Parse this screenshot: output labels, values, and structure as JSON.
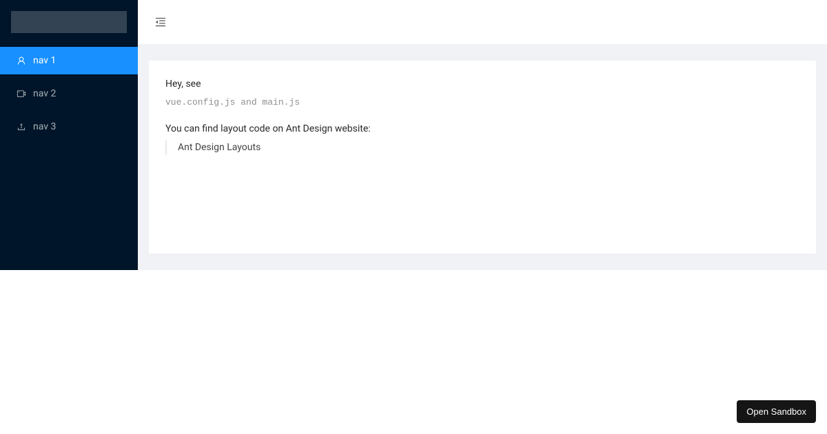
{
  "sidebar": {
    "items": [
      {
        "label": "nav 1",
        "icon": "user-icon",
        "selected": true
      },
      {
        "label": "nav 2",
        "icon": "video-camera-icon",
        "selected": false
      },
      {
        "label": "nav 3",
        "icon": "upload-icon",
        "selected": false
      }
    ]
  },
  "content": {
    "line1": "Hey, see",
    "code_line": "vue.config.js and main.js",
    "line2": "You can find layout code on Ant Design website:",
    "link_label": "Ant Design Layouts"
  },
  "sandbox_button": "Open Sandbox"
}
